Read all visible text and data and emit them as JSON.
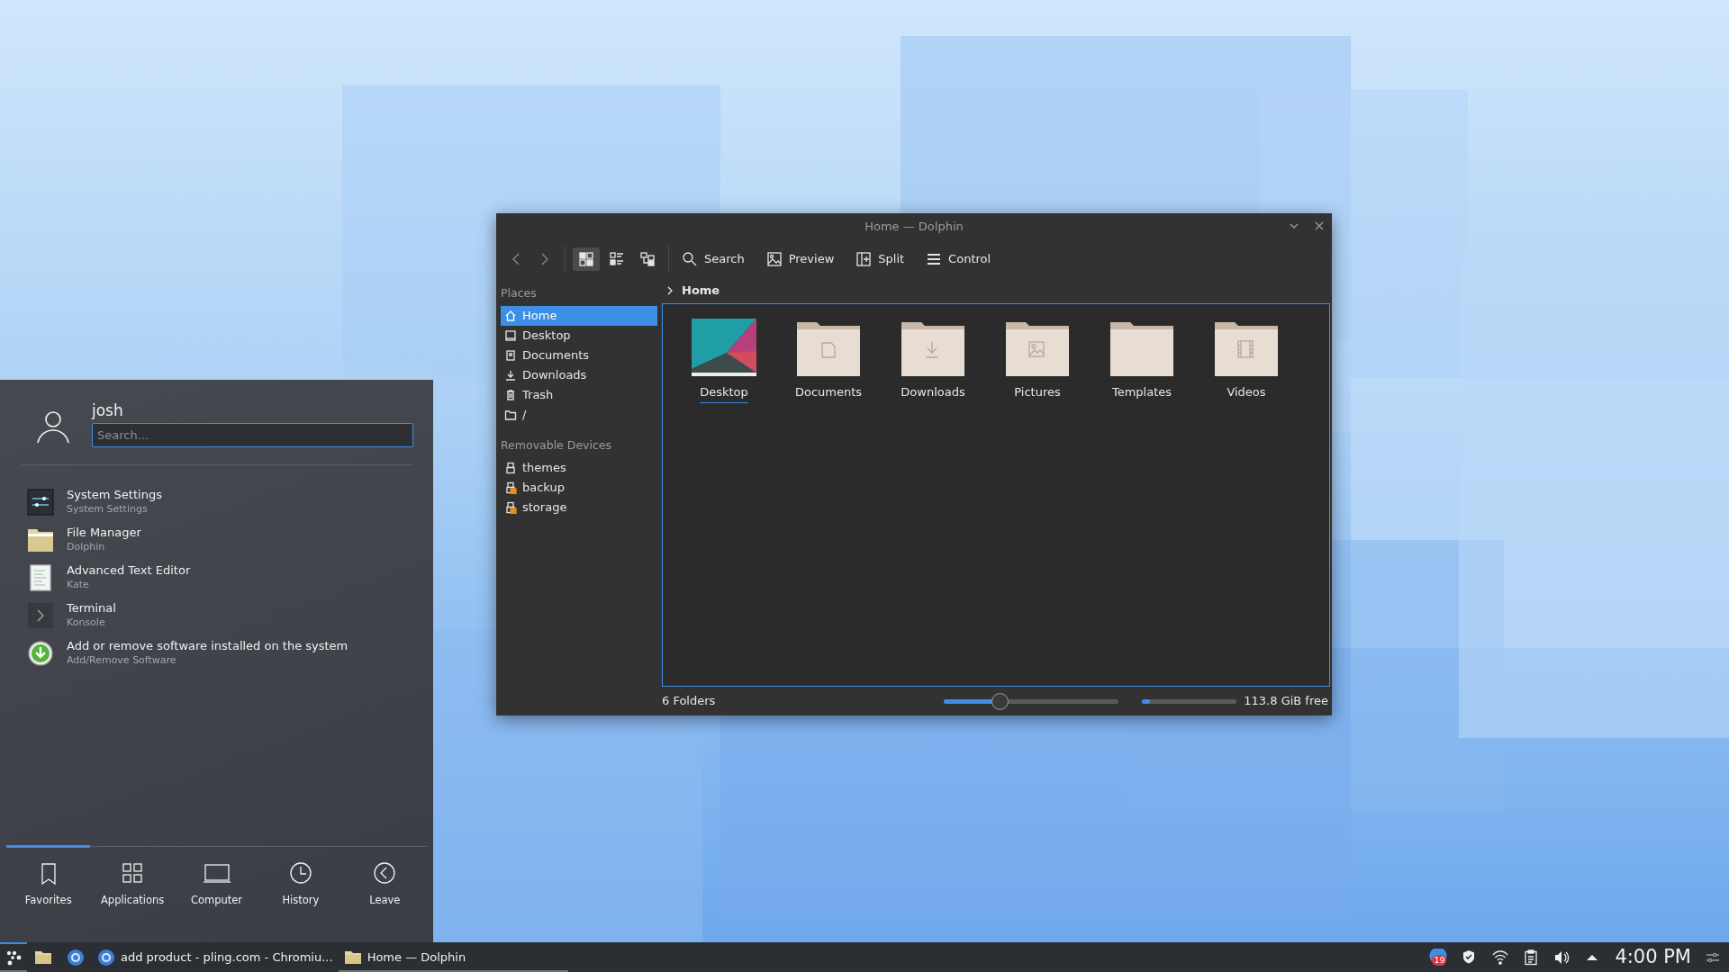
{
  "dolphin": {
    "title": "Home — Dolphin",
    "nav": [
      {
        "kind": "back"
      },
      {
        "kind": "forward"
      }
    ],
    "view_modes": [
      {
        "kind": "icons",
        "selected": true
      },
      {
        "kind": "compact",
        "selected": false
      },
      {
        "kind": "details",
        "selected": false
      }
    ],
    "actions": [
      {
        "kind": "search",
        "label": "Search"
      },
      {
        "kind": "preview",
        "label": "Preview"
      },
      {
        "kind": "split",
        "label": "Split"
      },
      {
        "kind": "menu",
        "label": "Control"
      }
    ],
    "sidebar": [
      {
        "title": "Places",
        "items": [
          {
            "kind": "home",
            "label": "Home",
            "selected": true
          },
          {
            "kind": "desktop",
            "label": "Desktop",
            "selected": false
          },
          {
            "kind": "documents",
            "label": "Documents",
            "selected": false
          },
          {
            "kind": "downloads",
            "label": "Downloads",
            "selected": false
          },
          {
            "kind": "trash",
            "label": "Trash",
            "selected": false
          },
          {
            "kind": "folder",
            "label": "/",
            "selected": false
          }
        ]
      },
      {
        "title": "Removable Devices",
        "items": [
          {
            "kind": "drive",
            "label": "themes",
            "selected": false
          },
          {
            "kind": "drive-unmounted",
            "label": "backup",
            "selected": false
          },
          {
            "kind": "drive-unmounted",
            "label": "storage",
            "selected": false
          }
        ]
      }
    ],
    "breadcrumb": "Home",
    "files": [
      {
        "kind": "desktop",
        "name": "Desktop",
        "selected": true
      },
      {
        "kind": "documents",
        "name": "Documents",
        "selected": false
      },
      {
        "kind": "downloads",
        "name": "Downloads",
        "selected": false
      },
      {
        "kind": "pictures",
        "name": "Pictures",
        "selected": false
      },
      {
        "kind": "templates",
        "name": "Templates",
        "selected": false
      },
      {
        "kind": "videos",
        "name": "Videos",
        "selected": false
      }
    ],
    "status": {
      "summary": "6 Folders",
      "zoom": {
        "level": 0.32
      },
      "disk": {
        "level": 0.08
      },
      "free": "113.8 GiB free"
    }
  },
  "start_menu": {
    "user": "josh",
    "search": {
      "placeholder": "Search..."
    },
    "apps": [
      {
        "kind": "settings",
        "title": "System Settings",
        "subtitle": "System Settings"
      },
      {
        "kind": "files",
        "title": "File Manager",
        "subtitle": "Dolphin"
      },
      {
        "kind": "editor",
        "title": "Advanced Text Editor",
        "subtitle": "Kate"
      },
      {
        "kind": "terminal",
        "title": "Terminal",
        "subtitle": "Konsole"
      },
      {
        "kind": "software",
        "title": "Add or remove software installed on the system",
        "subtitle": "Add/Remove Software"
      }
    ],
    "tabs": [
      {
        "kind": "favorites",
        "label": "Favorites",
        "selected": true
      },
      {
        "kind": "applications",
        "label": "Applications",
        "selected": false
      },
      {
        "kind": "computer",
        "label": "Computer",
        "selected": false
      },
      {
        "kind": "history",
        "label": "History",
        "selected": false
      },
      {
        "kind": "leave",
        "label": "Leave",
        "selected": false
      }
    ]
  },
  "taskbar": {
    "launcher": {
      "open": true
    },
    "pinned": [
      {
        "kind": "files"
      },
      {
        "kind": "browser"
      }
    ],
    "tasks": [
      {
        "kind": "browser",
        "label": "add product - pling.com - Chromiu...",
        "selected": false
      },
      {
        "kind": "files",
        "label": "Home — Dolphin",
        "selected": true
      }
    ],
    "tray": [
      {
        "kind": "notifications",
        "count": "19"
      },
      {
        "kind": "shield"
      },
      {
        "kind": "wifi"
      },
      {
        "kind": "clipboard"
      },
      {
        "kind": "volume"
      },
      {
        "kind": "expand"
      }
    ],
    "clock": "4:00 PM"
  }
}
